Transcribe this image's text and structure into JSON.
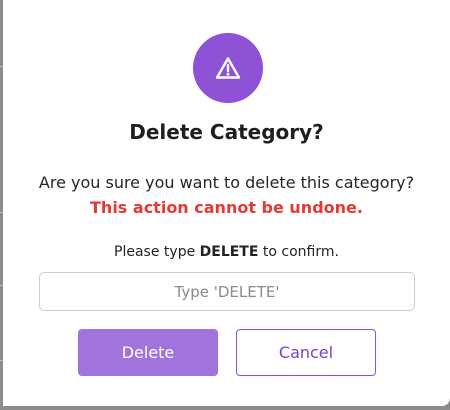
{
  "dialog": {
    "icon": "warning-triangle-icon",
    "title": "Delete Category?",
    "question": "Are you sure you want to delete this category?",
    "warning": "This action cannot be undone.",
    "instruction_prefix": "Please type ",
    "instruction_keyword": "DELETE",
    "instruction_suffix": " to confirm.",
    "input": {
      "value": "",
      "placeholder": "Type 'DELETE'"
    },
    "buttons": {
      "delete_label": "Delete",
      "cancel_label": "Cancel"
    }
  },
  "colors": {
    "accent": "#8e52d6",
    "delete_button": "#a173dd",
    "warning_text": "#e53935",
    "backdrop": "#8c8c8c"
  }
}
